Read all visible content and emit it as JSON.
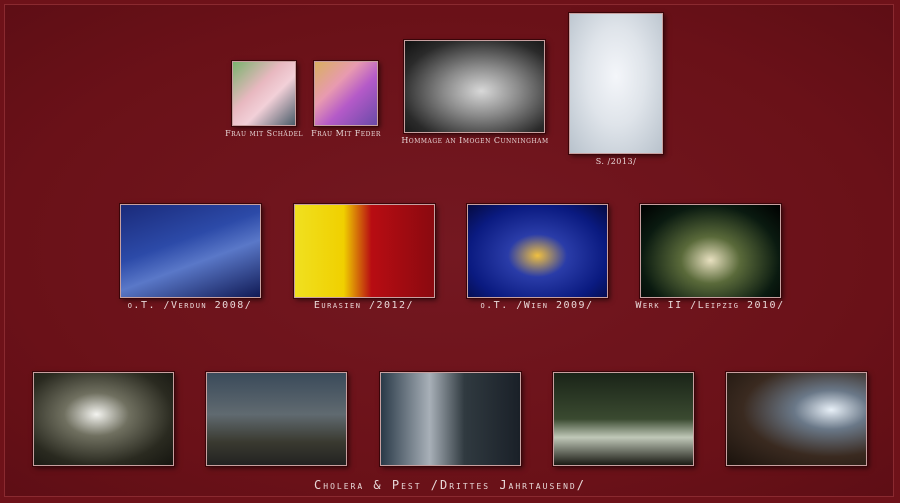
{
  "gallery": {
    "row1": [
      {
        "caption": "Frau mit Schädel",
        "icon": "photo-icon"
      },
      {
        "caption": "Frau Mit Feder",
        "icon": "photo-icon"
      },
      {
        "caption": "Hommage an Imogen Cunningham",
        "icon": "photo-icon"
      },
      {
        "caption": "S. /2013/",
        "icon": "photo-icon"
      }
    ],
    "row2": [
      {
        "caption": "o.T. /Verdun 2008/"
      },
      {
        "caption": "Eurasien /2012/"
      },
      {
        "caption": "o.T. /Wien 2009/"
      },
      {
        "caption": "Werk II /Leipzig 2010/"
      }
    ],
    "row3_caption": "Cholera & Pest /Drittes Jahrtausend/"
  },
  "colors": {
    "background": "#6e1219",
    "caption_text": "#e8d8d8",
    "thumb_border": "#c8a0a0"
  }
}
